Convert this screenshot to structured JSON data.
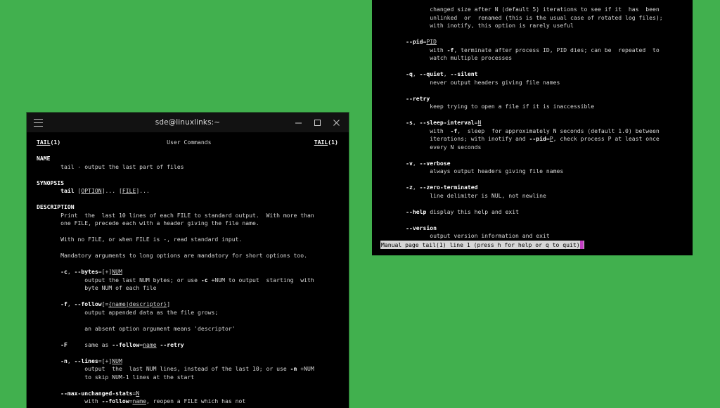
{
  "desktop": {
    "background_color": "#41b04e"
  },
  "left_window": {
    "titlebar": {
      "menu_icon": "hamburger-icon",
      "title": "sde@linuxlinks:~",
      "minimize_label": "minimize-icon",
      "maximize_label": "maximize-icon",
      "close_label": "close-icon"
    },
    "manpage": {
      "header_left": "TAIL(1)",
      "header_center": "User Commands",
      "header_right": "TAIL(1)",
      "content_lines": [
        "<span class=\"bu\">TAIL</span><span class=\"b\">(1)</span>                               User Commands                              <span class=\"bu\">TAIL</span><span class=\"b\">(1)</span>",
        "",
        "<span class=\"b\">NAME</span>",
        "       tail - output the last part of files",
        "",
        "<span class=\"b\">SYNOPSIS</span>",
        "       <span class=\"b\">tail</span> [<span class=\"u\">OPTION</span>]... [<span class=\"u\">FILE</span>]...",
        "",
        "<span class=\"b\">DESCRIPTION</span>",
        "       Print  the  last 10 lines of each FILE to standard output.  With more than",
        "       one FILE, precede each with a header giving the file name.",
        "",
        "       With no FILE, or when FILE is -, read standard input.",
        "",
        "       Mandatory arguments to long options are mandatory for short options too.",
        "",
        "       <span class=\"b\">-c</span>, <span class=\"b\">--bytes</span>=[+]<span class=\"u\">NUM</span>",
        "              output the last NUM bytes; or use <span class=\"b\">-c</span> +NUM to output  starting  with",
        "              byte NUM of each file",
        "",
        "       <span class=\"b\">-f</span>, <span class=\"b\">--follow</span>[=<span class=\"u\">{name|descriptor}</span>]",
        "              output appended data as the file grows;",
        "",
        "              an absent option argument means 'descriptor'",
        "",
        "       <span class=\"b\">-F</span>     same as <span class=\"b\">--follow</span>=<span class=\"u\">name</span> <span class=\"b\">--retry</span>",
        "",
        "       <span class=\"b\">-n</span>, <span class=\"b\">--lines</span>=[+]<span class=\"u\">NUM</span>",
        "              output  the  last NUM lines, instead of the last 10; or use <span class=\"b\">-n</span> +NUM",
        "              to skip NUM-1 lines at the start",
        "",
        "       <span class=\"b\">--max-unchanged-stats</span>=<span class=\"u\">N</span>",
        "              with <span class=\"b\">--follow</span>=<span class=\"u\">name</span>, reopen a FILE which has not"
      ]
    }
  },
  "right_window": {
    "manpage": {
      "content_lines": [
        "              changed size after N (default 5) iterations to see if it  has  been",
        "              unlinked  or  renamed (this is the usual case of rotated log files);",
        "              with inotify, this option is rarely useful",
        "",
        "       <span class=\"b\">--pid</span>=<span class=\"u\">PID</span>",
        "              with <span class=\"b\">-f</span>, terminate after process ID, PID dies; can be  repeated  to",
        "              watch multiple processes",
        "",
        "       <span class=\"b\">-q</span>, <span class=\"b\">--quiet</span>, <span class=\"b\">--silent</span>",
        "              never output headers giving file names",
        "",
        "       <span class=\"b\">--retry</span>",
        "              keep trying to open a file if it is inaccessible",
        "",
        "       <span class=\"b\">-s</span>, <span class=\"b\">--sleep-interval</span>=<span class=\"u\">N</span>",
        "              with  <span class=\"b\">-f</span>,  sleep  for approximately N seconds (default 1.0) between",
        "              iterations; with inotify and <span class=\"b\">--pid</span>=<span class=\"u\">P</span>, check process P at least once",
        "              every N seconds",
        "",
        "       <span class=\"b\">-v</span>, <span class=\"b\">--verbose</span>",
        "              always output headers giving file names",
        "",
        "       <span class=\"b\">-z</span>, <span class=\"b\">--zero-terminated</span>",
        "              line delimiter is NUL, not newline",
        "",
        "       <span class=\"b\">--help</span> display this help and exit",
        "",
        "       <span class=\"b\">--version</span>",
        "              output version information and exit"
      ]
    },
    "status_bar": {
      "text": "Manual page tail(1) line 1 (press h for help or q to quit)",
      "cursor_color": "#c23ec2",
      "background_color": "#d6d6d6",
      "text_color": "#000000"
    }
  }
}
